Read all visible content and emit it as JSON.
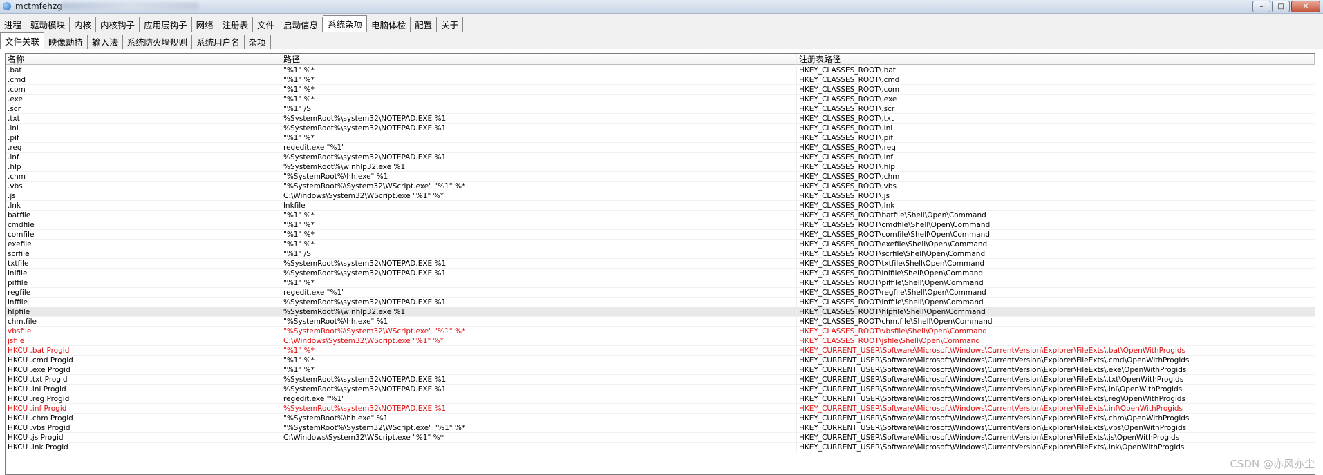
{
  "window": {
    "title": "mctmfehzg"
  },
  "tabs_main": [
    "进程",
    "驱动模块",
    "内核",
    "内核钩子",
    "应用层钩子",
    "网络",
    "注册表",
    "文件",
    "启动信息",
    "系统杂项",
    "电脑体检",
    "配置",
    "关于"
  ],
  "tabs_sub": [
    "文件关联",
    "映像劫持",
    "输入法",
    "系统防火墙规则",
    "系统用户名",
    "杂项"
  ],
  "columns": [
    "名称",
    "路径",
    "注册表路径"
  ],
  "rows": [
    {
      "name": ".bat",
      "path": "\"%1\" %*",
      "reg": "HKEY_CLASSES_ROOT\\.bat",
      "red": false
    },
    {
      "name": ".cmd",
      "path": "\"%1\" %*",
      "reg": "HKEY_CLASSES_ROOT\\.cmd",
      "red": false
    },
    {
      "name": ".com",
      "path": "\"%1\" %*",
      "reg": "HKEY_CLASSES_ROOT\\.com",
      "red": false
    },
    {
      "name": ".exe",
      "path": "\"%1\" %*",
      "reg": "HKEY_CLASSES_ROOT\\.exe",
      "red": false
    },
    {
      "name": ".scr",
      "path": "\"%1\" /S",
      "reg": "HKEY_CLASSES_ROOT\\.scr",
      "red": false
    },
    {
      "name": ".txt",
      "path": "%SystemRoot%\\system32\\NOTEPAD.EXE %1",
      "reg": "HKEY_CLASSES_ROOT\\.txt",
      "red": false
    },
    {
      "name": ".ini",
      "path": "%SystemRoot%\\system32\\NOTEPAD.EXE %1",
      "reg": "HKEY_CLASSES_ROOT\\.ini",
      "red": false
    },
    {
      "name": ".pif",
      "path": "\"%1\" %*",
      "reg": "HKEY_CLASSES_ROOT\\.pif",
      "red": false
    },
    {
      "name": ".reg",
      "path": "regedit.exe \"%1\"",
      "reg": "HKEY_CLASSES_ROOT\\.reg",
      "red": false
    },
    {
      "name": ".inf",
      "path": "%SystemRoot%\\system32\\NOTEPAD.EXE %1",
      "reg": "HKEY_CLASSES_ROOT\\.inf",
      "red": false
    },
    {
      "name": ".hlp",
      "path": "%SystemRoot%\\winhlp32.exe %1",
      "reg": "HKEY_CLASSES_ROOT\\.hlp",
      "red": false
    },
    {
      "name": ".chm",
      "path": "\"%SystemRoot%\\hh.exe\" %1",
      "reg": "HKEY_CLASSES_ROOT\\.chm",
      "red": false
    },
    {
      "name": ".vbs",
      "path": "\"%SystemRoot%\\System32\\WScript.exe\" \"%1\" %*",
      "reg": "HKEY_CLASSES_ROOT\\.vbs",
      "red": false
    },
    {
      "name": ".js",
      "path": "C:\\Windows\\System32\\WScript.exe \"%1\" %*",
      "reg": "HKEY_CLASSES_ROOT\\.js",
      "red": false
    },
    {
      "name": ".lnk",
      "path": "lnkfile",
      "reg": "HKEY_CLASSES_ROOT\\.lnk",
      "red": false
    },
    {
      "name": "batfile",
      "path": "\"%1\" %*",
      "reg": "HKEY_CLASSES_ROOT\\batfile\\Shell\\Open\\Command",
      "red": false
    },
    {
      "name": "cmdfile",
      "path": "\"%1\" %*",
      "reg": "HKEY_CLASSES_ROOT\\cmdfile\\Shell\\Open\\Command",
      "red": false
    },
    {
      "name": "comfile",
      "path": "\"%1\" %*",
      "reg": "HKEY_CLASSES_ROOT\\comfile\\Shell\\Open\\Command",
      "red": false
    },
    {
      "name": "exefile",
      "path": "\"%1\" %*",
      "reg": "HKEY_CLASSES_ROOT\\exefile\\Shell\\Open\\Command",
      "red": false
    },
    {
      "name": "scrfile",
      "path": "\"%1\" /S",
      "reg": "HKEY_CLASSES_ROOT\\scrfile\\Shell\\Open\\Command",
      "red": false
    },
    {
      "name": "txtfile",
      "path": "%SystemRoot%\\system32\\NOTEPAD.EXE %1",
      "reg": "HKEY_CLASSES_ROOT\\txtfile\\Shell\\Open\\Command",
      "red": false
    },
    {
      "name": "inifile",
      "path": "%SystemRoot%\\system32\\NOTEPAD.EXE %1",
      "reg": "HKEY_CLASSES_ROOT\\inifile\\Shell\\Open\\Command",
      "red": false
    },
    {
      "name": "piffile",
      "path": "\"%1\" %*",
      "reg": "HKEY_CLASSES_ROOT\\piffile\\Shell\\Open\\Command",
      "red": false
    },
    {
      "name": "regfile",
      "path": "regedit.exe \"%1\"",
      "reg": "HKEY_CLASSES_ROOT\\regfile\\Shell\\Open\\Command",
      "red": false
    },
    {
      "name": "inffile",
      "path": "%SystemRoot%\\system32\\NOTEPAD.EXE %1",
      "reg": "HKEY_CLASSES_ROOT\\inffile\\Shell\\Open\\Command",
      "red": false
    },
    {
      "name": "hlpfile",
      "path": "%SystemRoot%\\winhlp32.exe %1",
      "reg": "HKEY_CLASSES_ROOT\\hlpfile\\Shell\\Open\\Command",
      "red": false,
      "selected": true
    },
    {
      "name": "chm.file",
      "path": "\"%SystemRoot%\\hh.exe\" %1",
      "reg": "HKEY_CLASSES_ROOT\\chm.file\\Shell\\Open\\Command",
      "red": false
    },
    {
      "name": "vbsfile",
      "path": "\"%SystemRoot%\\System32\\WScript.exe\" \"%1\" %*",
      "reg": "HKEY_CLASSES_ROOT\\vbsfile\\Shell\\Open\\Command",
      "red": true
    },
    {
      "name": "jsfile",
      "path": "C:\\Windows\\System32\\WScript.exe \"%1\" %*",
      "reg": "HKEY_CLASSES_ROOT\\jsfile\\Shell\\Open\\Command",
      "red": true
    },
    {
      "name": "HKCU .bat Progid",
      "path": "\"%1\" %*",
      "reg": "HKEY_CURRENT_USER\\Software\\Microsoft\\Windows\\CurrentVersion\\Explorer\\FileExts\\.bat\\OpenWithProgids",
      "red": true
    },
    {
      "name": "HKCU .cmd Progid",
      "path": "\"%1\" %*",
      "reg": "HKEY_CURRENT_USER\\Software\\Microsoft\\Windows\\CurrentVersion\\Explorer\\FileExts\\.cmd\\OpenWithProgids",
      "red": false
    },
    {
      "name": "HKCU .exe Progid",
      "path": "\"%1\" %*",
      "reg": "HKEY_CURRENT_USER\\Software\\Microsoft\\Windows\\CurrentVersion\\Explorer\\FileExts\\.exe\\OpenWithProgids",
      "red": false
    },
    {
      "name": "HKCU .txt Progid",
      "path": "%SystemRoot%\\system32\\NOTEPAD.EXE %1",
      "reg": "HKEY_CURRENT_USER\\Software\\Microsoft\\Windows\\CurrentVersion\\Explorer\\FileExts\\.txt\\OpenWithProgids",
      "red": false
    },
    {
      "name": "HKCU .ini Progid",
      "path": "%SystemRoot%\\system32\\NOTEPAD.EXE %1",
      "reg": "HKEY_CURRENT_USER\\Software\\Microsoft\\Windows\\CurrentVersion\\Explorer\\FileExts\\.ini\\OpenWithProgids",
      "red": false
    },
    {
      "name": "HKCU .reg Progid",
      "path": "regedit.exe \"%1\"",
      "reg": "HKEY_CURRENT_USER\\Software\\Microsoft\\Windows\\CurrentVersion\\Explorer\\FileExts\\.reg\\OpenWithProgids",
      "red": false
    },
    {
      "name": "HKCU .inf Progid",
      "path": "%SystemRoot%\\system32\\NOTEPAD.EXE %1",
      "reg": "HKEY_CURRENT_USER\\Software\\Microsoft\\Windows\\CurrentVersion\\Explorer\\FileExts\\.inf\\OpenWithProgids",
      "red": true
    },
    {
      "name": "HKCU .chm Progid",
      "path": "\"%SystemRoot%\\hh.exe\" %1",
      "reg": "HKEY_CURRENT_USER\\Software\\Microsoft\\Windows\\CurrentVersion\\Explorer\\FileExts\\.chm\\OpenWithProgids",
      "red": false
    },
    {
      "name": "HKCU .vbs Progid",
      "path": "\"%SystemRoot%\\System32\\WScript.exe\" \"%1\" %*",
      "reg": "HKEY_CURRENT_USER\\Software\\Microsoft\\Windows\\CurrentVersion\\Explorer\\FileExts\\.vbs\\OpenWithProgids",
      "red": false
    },
    {
      "name": "HKCU .js Progid",
      "path": "C:\\Windows\\System32\\WScript.exe \"%1\" %*",
      "reg": "HKEY_CURRENT_USER\\Software\\Microsoft\\Windows\\CurrentVersion\\Explorer\\FileExts\\.js\\OpenWithProgids",
      "red": false
    },
    {
      "name": "HKCU .lnk Progid",
      "path": "",
      "reg": "HKEY_CURRENT_USER\\Software\\Microsoft\\Windows\\CurrentVersion\\Explorer\\FileExts\\.lnk\\OpenWithProgids",
      "red": false
    }
  ],
  "colors": {
    "red": "#e01010",
    "selected": "#e9e9e9"
  },
  "watermark": "CSDN @亦风亦尘"
}
